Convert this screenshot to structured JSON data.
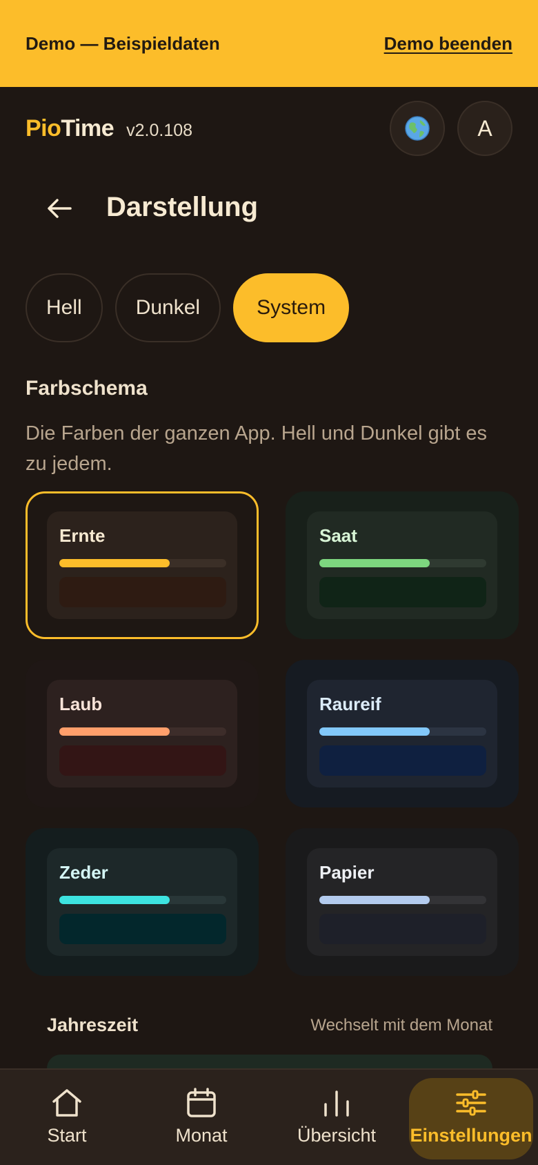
{
  "demo_banner": {
    "text": "Demo — Beispieldaten",
    "end_label": "Demo beenden"
  },
  "header": {
    "logo_part1": "Pio",
    "logo_part2": "Time",
    "version": "v2.0.108",
    "language_icon": "globe-icon",
    "avatar_initial": "A"
  },
  "page": {
    "title": "Darstellung",
    "back_icon": "arrow-left-icon"
  },
  "modes": {
    "items": [
      "Hell",
      "Dunkel",
      "System"
    ],
    "selected": "System"
  },
  "color_scheme": {
    "title": "Farbschema",
    "description": "Die Farben der ganzen App. Hell und Dunkel gibt es zu jedem.",
    "selected": "Ernte",
    "schemes": [
      {
        "name": "Ernte",
        "accent": "#fcbd2a",
        "name_color": "#f7ead2",
        "outer": "#1e1713",
        "card": "#2c221c",
        "track": "#3b2f27",
        "block": "#2e1b12"
      },
      {
        "name": "Saat",
        "accent": "#7dd67f",
        "name_color": "#d8f5d6",
        "outer": "#18201a",
        "card": "#212a23",
        "track": "#2f3a31",
        "block": "#102417"
      },
      {
        "name": "Laub",
        "accent": "#ff9f6b",
        "name_color": "#f8e3d8",
        "outer": "#1f1715",
        "card": "#2d211f",
        "track": "#3d2d2a",
        "block": "#331515"
      },
      {
        "name": "Raureif",
        "accent": "#82c8fa",
        "name_color": "#dcecf9",
        "outer": "#161b22",
        "card": "#1f2530",
        "track": "#2c3442",
        "block": "#0f2040"
      },
      {
        "name": "Zeder",
        "accent": "#3de3e0",
        "name_color": "#d4f6f5",
        "outer": "#141d1e",
        "card": "#1d2829",
        "track": "#293738",
        "block": "#03272c"
      },
      {
        "name": "Papier",
        "accent": "#b3cbee",
        "name_color": "#eef0f4",
        "outer": "#1a1a1b",
        "card": "#242426",
        "track": "#333336",
        "block": "#1e2029"
      }
    ]
  },
  "season": {
    "title": "Jahreszeit",
    "hint": "Wechselt mit dem Monat"
  },
  "nav": {
    "items": [
      {
        "label": "Start",
        "icon": "home-icon"
      },
      {
        "label": "Monat",
        "icon": "calendar-icon"
      },
      {
        "label": "Übersicht",
        "icon": "bar-chart-icon"
      },
      {
        "label": "Einstellungen",
        "icon": "sliders-icon"
      }
    ],
    "active": "Einstellungen"
  }
}
